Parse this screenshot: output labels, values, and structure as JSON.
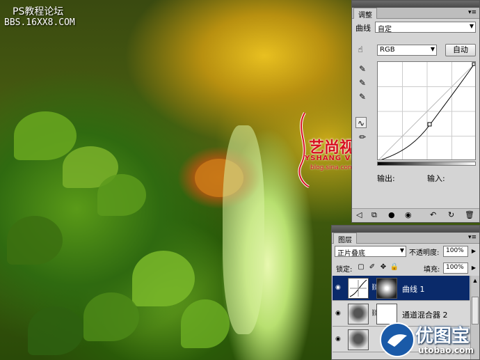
{
  "watermark": {
    "line1": "PS教程论坛",
    "line2": "BBS.16XX8.COM"
  },
  "brand_mid": {
    "cn": "艺尚视觉",
    "en": "YSHANG VISION",
    "url": "blog.sina.com.cn/adobech"
  },
  "adjust_panel": {
    "tab": "调整",
    "curve_label": "曲线",
    "preset": "自定",
    "channel": "RGB",
    "auto_button": "自动",
    "output_label": "输出:",
    "input_label": "输入:"
  },
  "layers_panel": {
    "tab": "图层",
    "blend_mode": "正片叠底",
    "opacity_label": "不透明度:",
    "opacity_value": "100%",
    "lock_label": "锁定:",
    "fill_label": "填充:",
    "fill_value": "100%",
    "layers": [
      {
        "name": "曲线 1",
        "selected": true
      },
      {
        "name": "通道混合器 2",
        "selected": false
      },
      {
        "name": "",
        "selected": false
      }
    ]
  },
  "logo_br": {
    "cn": "优图宝",
    "url": "utobao.com"
  },
  "colors": {
    "selection": "#0a2a6a",
    "brand_red": "#d81020",
    "brand_blue": "#1a5aa8"
  },
  "icons": [
    "hand-target-icon",
    "eyedropper-black-icon",
    "eyedropper-gray-icon",
    "eyedropper-white-icon",
    "curve-tool-icon",
    "pencil-icon",
    "panel-menu-icon",
    "eye-icon",
    "lock-icon",
    "chain-icon",
    "back-arrow-icon",
    "clip-icon",
    "visibility-icon",
    "reset-icon",
    "trash-icon"
  ]
}
